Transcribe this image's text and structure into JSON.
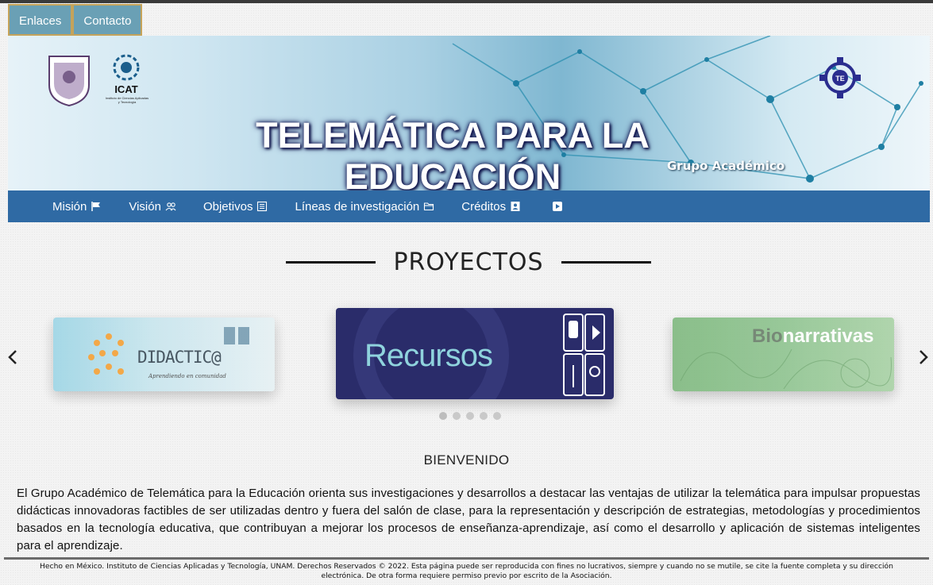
{
  "top_links": [
    "Enlaces",
    "Contacto"
  ],
  "banner": {
    "title": "TELEMÁTICA PARA LA EDUCACIÓN",
    "subtitle": "Grupo Académico",
    "icat_label": "ICAT",
    "icat_small": "Instituto de Ciencias Aplicadas y Tecnología"
  },
  "nav": [
    {
      "label": "Misión",
      "icon": "flag-icon"
    },
    {
      "label": "Visión",
      "icon": "people-icon"
    },
    {
      "label": "Objetivos",
      "icon": "list-icon"
    },
    {
      "label": "Líneas de investigación",
      "icon": "folder-icon"
    },
    {
      "label": "Créditos",
      "icon": "id-card-icon"
    },
    {
      "label": "",
      "icon": "youtube-icon"
    }
  ],
  "section_title": "PROYECTOS",
  "carousel": {
    "cards": [
      {
        "title": "DIDACTIC@",
        "tagline": "Aprendiendo en comunidad"
      },
      {
        "title": "Recursos"
      },
      {
        "title_prefix": "Bio",
        "title_suffix": "narrativas"
      }
    ],
    "dot_count": 5,
    "active_dot": 0
  },
  "welcome": {
    "title": "BIENVENIDO",
    "body": "El Grupo Académico de Telemática para la Educación orienta sus investigaciones y desarrollos a destacar las ventajas de utilizar la telemática para impulsar propuestas didácticas innovadoras factibles de ser utilizadas dentro y fuera del salón de clase, para la representación y descripción de estrategias, metodologías y procedimientos basados en la tecnología educativa, que contribuyan a mejorar los procesos de enseñanza-aprendizaje, así como el desarrollo y aplicación de sistemas inteligentes para el aprendizaje."
  },
  "footer": {
    "line1": "Hecho en México. Instituto de Ciencias Aplicadas y Tecnología, UNAM. Derechos Reservados © 2022. Esta página puede ser reproducida con fines no lucrativos, siempre y cuando no se mutile, se cite la fuente completa y su dirección",
    "line2": "electrónica. De otra forma requiere permiso previo por escrito de la Asociación."
  },
  "colors": {
    "nav_bg": "#2f6aa4",
    "top_link_bg": "#6aa0b5",
    "top_link_border": "#c5a35a"
  }
}
